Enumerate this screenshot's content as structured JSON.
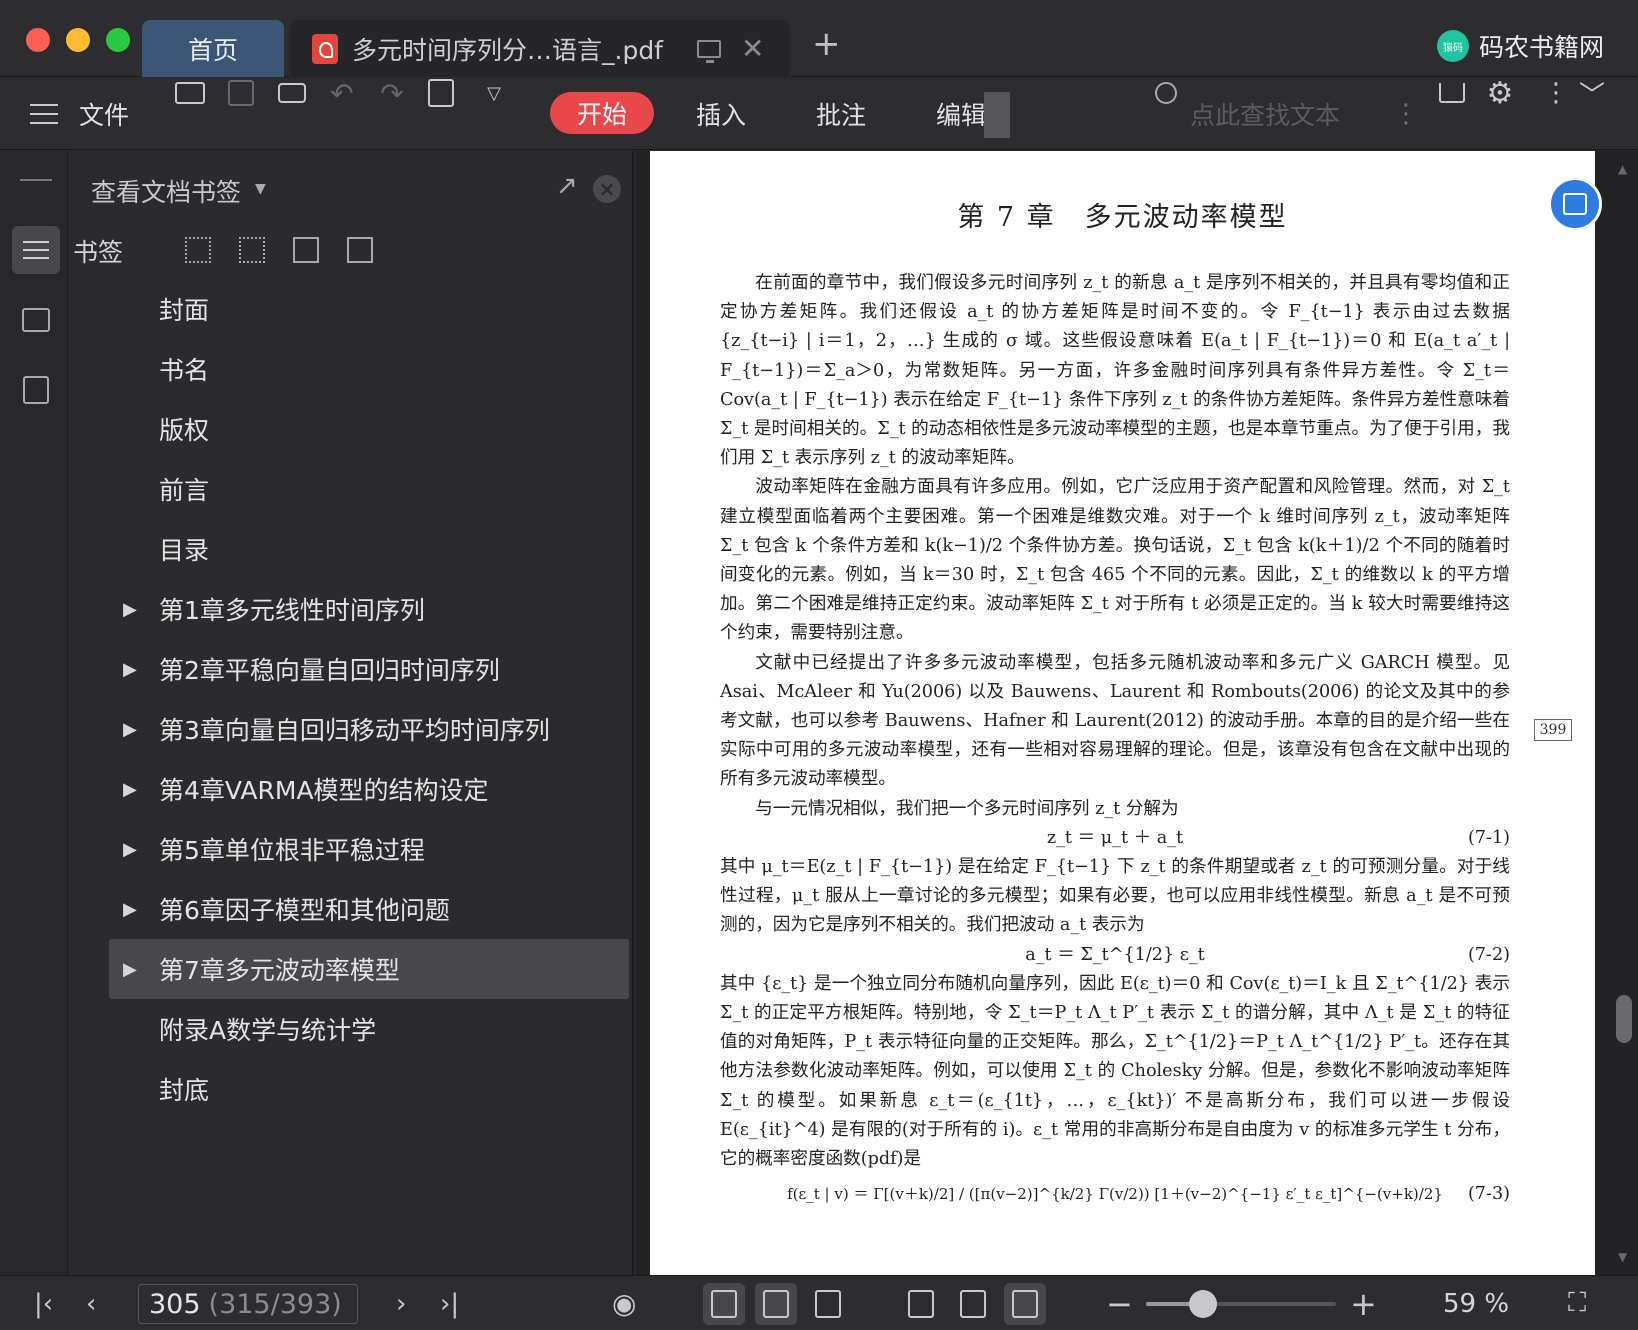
{
  "titlebar": {
    "home_tab": "首页",
    "doc_tab": "多元时间序列分…语言_.pdf",
    "new_tab_icon": "+",
    "brand_name": "码农书籍网",
    "brand_logo_text": "猿码"
  },
  "toolbar": {
    "file_label": "文件",
    "menu": {
      "start": "开始",
      "insert": "插入",
      "annotate": "批注",
      "edit": "编辑"
    },
    "search_placeholder": "点此查找文本"
  },
  "sidebar": {
    "panel_title": "查看文档书签",
    "bookmark_label": "书签",
    "items": [
      {
        "label": "封面",
        "expandable": false
      },
      {
        "label": "书名",
        "expandable": false
      },
      {
        "label": "版权",
        "expandable": false
      },
      {
        "label": "前言",
        "expandable": false
      },
      {
        "label": "目录",
        "expandable": false
      },
      {
        "label": "第1章多元线性时间序列",
        "expandable": true
      },
      {
        "label": "第2章平稳向量自回归时间序列",
        "expandable": true
      },
      {
        "label": "第3章向量自回归移动平均时间序列",
        "expandable": true
      },
      {
        "label": "第4章VARMA模型的结构设定",
        "expandable": true
      },
      {
        "label": "第5章单位根非平稳过程",
        "expandable": true
      },
      {
        "label": "第6章因子模型和其他问题",
        "expandable": true
      },
      {
        "label": "第7章多元波动率模型",
        "expandable": true,
        "selected": true
      },
      {
        "label": "附录A数学与统计学",
        "expandable": false
      },
      {
        "label": "封底",
        "expandable": false
      }
    ]
  },
  "document": {
    "chapter_title": "第 7 章　多元波动率模型",
    "printed_page_number": "399",
    "paragraphs": {
      "p1": "在前面的章节中，我们假设多元时间序列 z_t 的新息 a_t 是序列不相关的，并且具有零均值和正定协方差矩阵。我们还假设 a_t 的协方差矩阵是时间不变的。令 F_{t−1} 表示由过去数据 {z_{t−i} | i＝1，2，…} 生成的 σ 域。这些假设意味着 E(a_t | F_{t−1})＝0 和 E(a_t a′_t | F_{t−1})＝Σ_a＞0，为常数矩阵。另一方面，许多金融时间序列具有条件异方差性。令 Σ_t＝Cov(a_t | F_{t−1}) 表示在给定 F_{t−1} 条件下序列 z_t 的条件协方差矩阵。条件异方差性意味着 Σ_t 是时间相关的。Σ_t 的动态相依性是多元波动率模型的主题，也是本章节重点。为了便于引用，我们用 Σ_t 表示序列 z_t 的波动率矩阵。",
      "p2": "波动率矩阵在金融方面具有许多应用。例如，它广泛应用于资产配置和风险管理。然而，对 Σ_t 建立模型面临着两个主要困难。第一个困难是维数灾难。对于一个 k 维时间序列 z_t，波动率矩阵 Σ_t 包含 k 个条件方差和 k(k−1)/2 个条件协方差。换句话说，Σ_t 包含 k(k＋1)/2 个不同的随着时间变化的元素。例如，当 k＝30 时，Σ_t 包含 465 个不同的元素。因此，Σ_t 的维数以 k 的平方增加。第二个困难是维持正定约束。波动率矩阵 Σ_t 对于所有 t 必须是正定的。当 k 较大时需要维持这个约束，需要特别注意。",
      "p3": "文献中已经提出了许多多元波动率模型，包括多元随机波动率和多元广义 GARCH 模型。见 Asai、McAleer 和 Yu(2006) 以及 Bauwens、Laurent 和 Rombouts(2006) 的论文及其中的参考文献，也可以参考 Bauwens、Hafner 和 Laurent(2012) 的波动手册。本章的目的是介绍一些在实际中可用的多元波动率模型，还有一些相对容易理解的理论。但是，该章没有包含在文献中出现的所有多元波动率模型。",
      "p4": "与一元情况相似，我们把一个多元时间序列 z_t 分解为",
      "eq1": "z_t ＝ μ_t ＋ a_t",
      "eq1_num": "(7-1)",
      "p5": "其中 μ_t＝E(z_t | F_{t−1}) 是在给定 F_{t−1} 下 z_t 的条件期望或者 z_t 的可预测分量。对于线性过程，μ_t 服从上一章讨论的多元模型；如果有必要，也可以应用非线性模型。新息 a_t 是不可预测的，因为它是序列不相关的。我们把波动 a_t 表示为",
      "eq2": "a_t ＝ Σ_t^{1/2} ε_t",
      "eq2_num": "(7-2)",
      "p6": "其中 {ε_t} 是一个独立同分布随机向量序列，因此 E(ε_t)＝0 和 Cov(ε_t)＝I_k 且 Σ_t^{1/2} 表示 Σ_t 的正定平方根矩阵。特别地，令 Σ_t＝P_t Λ_t P′_t 表示 Σ_t 的谱分解，其中 Λ_t 是 Σ_t 的特征值的对角矩阵，P_t 表示特征向量的正交矩阵。那么，Σ_t^{1/2}＝P_t Λ_t^{1/2} P′_t。还存在其他方法参数化波动率矩阵。例如，可以使用 Σ_t 的 Cholesky 分解。但是，参数化不影响波动率矩阵 Σ_t 的模型。如果新息 ε_t＝(ε_{1t}，…，ε_{kt})′ 不是高斯分布，我们可以进一步假设 E(ε_{it}^4) 是有限的(对于所有的 i)。ε_t 常用的非高斯分布是自由度为 v 的标准多元学生 t 分布，它的概率密度函数(pdf)是",
      "eq3": "f(ε_t | v) ＝ Γ[(v＋k)/2] / ([π(v−2)]^{k/2} Γ(v/2)) [1＋(v−2)^{−1} ε′_t ε_t]^{−(v+k)/2}",
      "eq3_num": "(7-3)"
    }
  },
  "statusbar": {
    "current_page": "305",
    "page_detail": "(315/393)",
    "zoom_label": "59 %",
    "zoom_fraction": 0.3
  }
}
